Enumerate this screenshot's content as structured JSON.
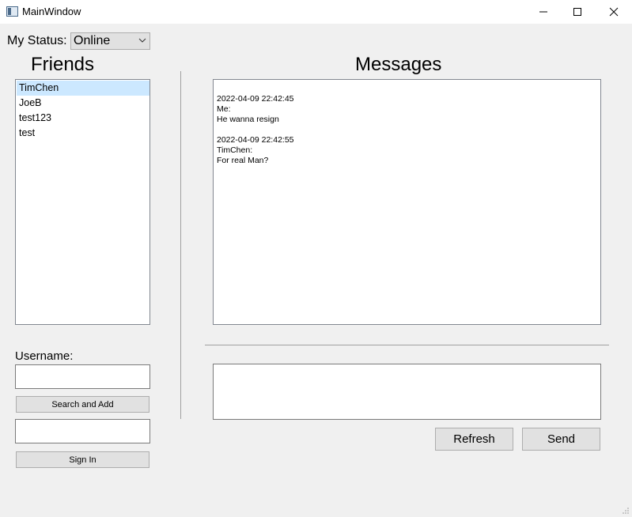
{
  "window": {
    "title": "MainWindow",
    "icons": {
      "app": "window-app-icon",
      "minimize": "minimize-icon",
      "maximize": "maximize-icon",
      "close": "close-icon"
    }
  },
  "status": {
    "label": "My Status:",
    "selected": "Online"
  },
  "friends": {
    "heading": "Friends",
    "items": [
      {
        "name": "TimChen",
        "selected": true
      },
      {
        "name": "JoeB",
        "selected": false
      },
      {
        "name": "test123",
        "selected": false
      },
      {
        "name": "test",
        "selected": false
      }
    ]
  },
  "messages": {
    "heading": "Messages",
    "entries": [
      {
        "timestamp": "2022-04-09 22:42:45",
        "sender": "Me:",
        "text": "He wanna resign"
      },
      {
        "timestamp": "2022-04-09 22:42:55",
        "sender": "TimChen:",
        "text": "For real Man?"
      }
    ],
    "compose_value": ""
  },
  "sidebar": {
    "username_label": "Username:",
    "username_value": "",
    "search_add_label": "Search and Add",
    "signin_value": "",
    "signin_label": "Sign In"
  },
  "actions": {
    "refresh_label": "Refresh",
    "send_label": "Send"
  }
}
